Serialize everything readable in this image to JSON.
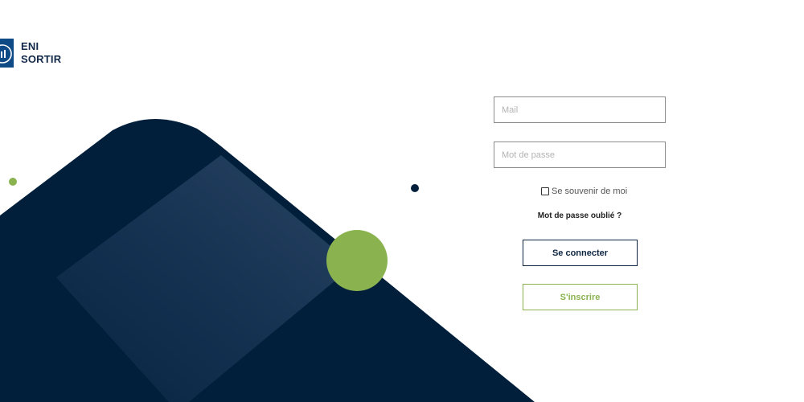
{
  "brand": {
    "line1": "ENI",
    "line2": "SORTIR"
  },
  "login_form": {
    "email_placeholder": "Mail",
    "password_placeholder": "Mot de passe",
    "remember_label": "Se souvenir de moi",
    "forgot_label": "Mot de passe oublié ?",
    "login_button": "Se connecter",
    "register_button": "S'inscrire"
  },
  "colors": {
    "navy": "#011f3b",
    "green": "#8ab350",
    "logo_blue": "#0d4a86"
  }
}
